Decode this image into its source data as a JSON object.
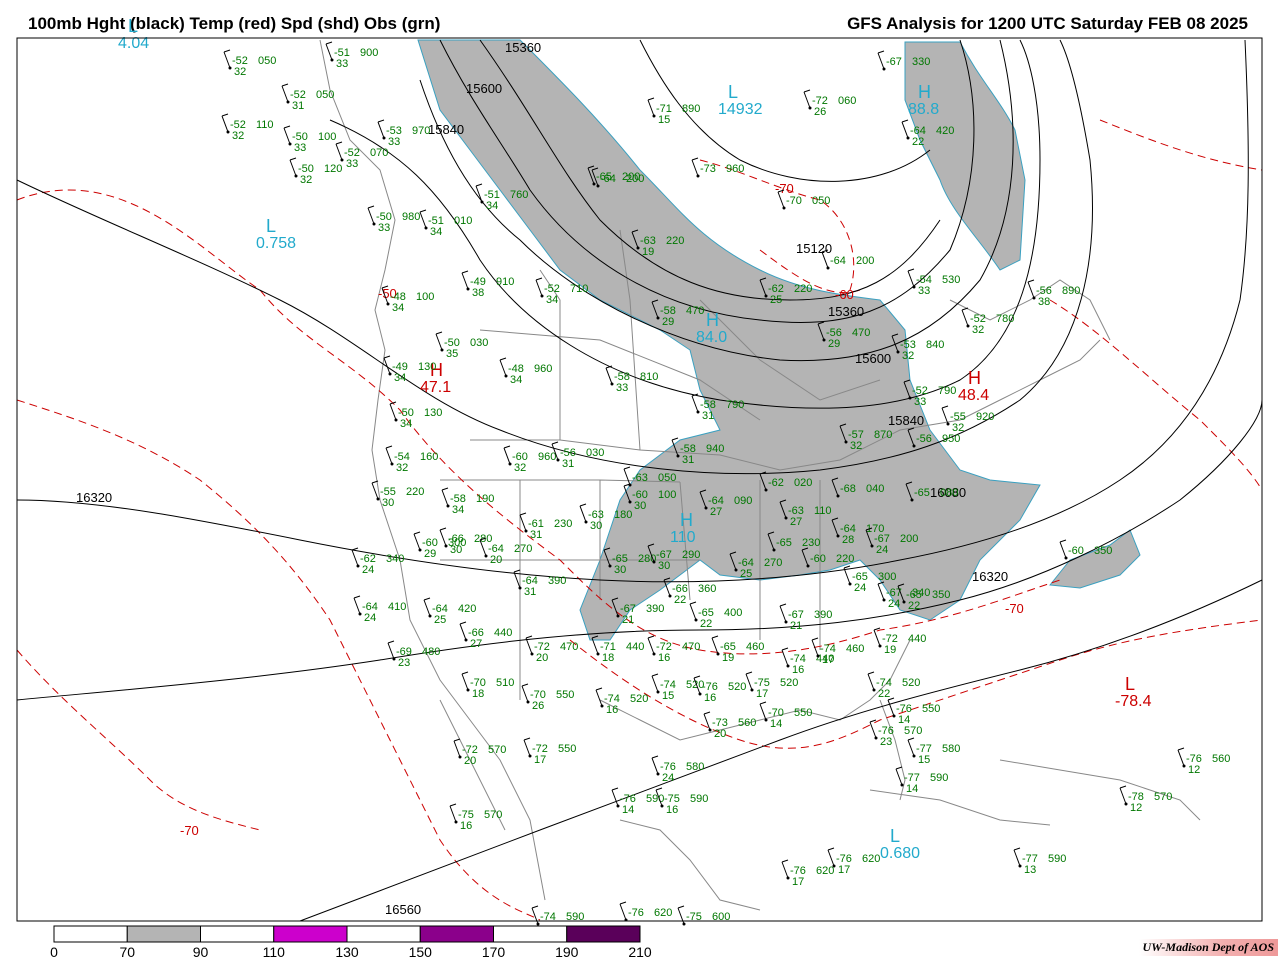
{
  "header": {
    "title_left": "100mb Hght (black) Temp (red) Spd (shd) Obs (grn)",
    "title_right": "GFS Analysis for 1200 UTC Saturday  FEB 08 2025"
  },
  "colors": {
    "height_contour": "#000000",
    "temp_contour": "#cc0000",
    "wind_shade": "#b4b4b4",
    "obs_text": "#007700",
    "center_label": "#22aacc",
    "geo_lines": "#888888"
  },
  "height_labels": [
    "15360",
    "15600",
    "15840",
    "15120",
    "15360",
    "15600",
    "15840",
    "16080",
    "16320",
    "16320",
    "16560"
  ],
  "centers": [
    {
      "type": "L",
      "value": "4.04"
    },
    {
      "type": "L",
      "value": "0.758"
    },
    {
      "type": "L",
      "value": "14932"
    },
    {
      "type": "H",
      "value": "88.8"
    },
    {
      "type": "H",
      "value": "84.0"
    },
    {
      "type": "H",
      "value": "110"
    },
    {
      "type": "H",
      "value": "47.1"
    },
    {
      "type": "H",
      "value": "48.4"
    },
    {
      "type": "L",
      "value": "-78.4"
    },
    {
      "type": "L",
      "value": "0.680"
    }
  ],
  "temp_labels": [
    "-70",
    "-60",
    "-50",
    "-70",
    "-70"
  ],
  "observations": [
    {
      "t": "-52",
      "d": "32",
      "h": "050"
    },
    {
      "t": "-51",
      "d": "33",
      "h": "900"
    },
    {
      "t": "-52",
      "d": "31",
      "h": "050"
    },
    {
      "t": "-53",
      "d": "33",
      "h": "970"
    },
    {
      "t": "-52",
      "d": "32",
      "h": "110"
    },
    {
      "t": "-50",
      "d": "33",
      "h": "100"
    },
    {
      "t": "-52",
      "d": "33",
      "h": "070"
    },
    {
      "t": "-50",
      "d": "32",
      "h": "120"
    },
    {
      "t": "-50",
      "d": "33",
      "h": "980"
    },
    {
      "t": "-51",
      "d": "34",
      "h": "010"
    },
    {
      "t": "-51",
      "d": "34",
      "h": "760"
    },
    {
      "t": "-52",
      "d": "34",
      "h": "710"
    },
    {
      "t": "-49",
      "d": "38",
      "h": "910"
    },
    {
      "t": "-48",
      "d": "34",
      "h": "100"
    },
    {
      "t": "-50",
      "d": "35",
      "h": "030"
    },
    {
      "t": "-49",
      "d": "34",
      "h": "130"
    },
    {
      "t": "-48",
      "d": "34",
      "h": "960"
    },
    {
      "t": "-50",
      "d": "34",
      "h": "130"
    },
    {
      "t": "-54",
      "d": "32",
      "h": "160"
    },
    {
      "t": "-60",
      "d": "32",
      "h": "960"
    },
    {
      "t": "-56",
      "d": "31",
      "h": "030"
    },
    {
      "t": "-58",
      "d": "33",
      "h": "810"
    },
    {
      "t": "-55",
      "d": "30",
      "h": "220"
    },
    {
      "t": "-58",
      "d": "34",
      "h": "190"
    },
    {
      "t": "-60",
      "d": "29",
      "h": "300"
    },
    {
      "t": "-66",
      "d": "30",
      "h": "280"
    },
    {
      "t": "-62",
      "d": "24",
      "h": "340"
    },
    {
      "t": "-61",
      "d": "31",
      "h": "230"
    },
    {
      "t": "-64",
      "d": "20",
      "h": "270"
    },
    {
      "t": "-64",
      "d": "31",
      "h": "390"
    },
    {
      "t": "-64",
      "d": "24",
      "h": "410"
    },
    {
      "t": "-64",
      "d": "25",
      "h": "420"
    },
    {
      "t": "-66",
      "d": "27",
      "h": "440"
    },
    {
      "t": "-69",
      "d": "23",
      "h": "480"
    },
    {
      "t": "-70",
      "d": "18",
      "h": "510"
    },
    {
      "t": "-70",
      "d": "26",
      "h": "550"
    },
    {
      "t": "-72",
      "d": "20",
      "h": "570"
    },
    {
      "t": "-72",
      "d": "17",
      "h": "550"
    },
    {
      "t": "-75",
      "d": "16",
      "h": "570"
    },
    {
      "t": "-72",
      "d": "20",
      "h": "470"
    },
    {
      "t": "-71",
      "d": "18",
      "h": "440"
    },
    {
      "t": "-72",
      "d": "16",
      "h": "470"
    },
    {
      "t": "-74",
      "d": "16",
      "h": "520"
    },
    {
      "t": "-74",
      "d": "15",
      "h": "520"
    },
    {
      "t": "-76",
      "d": "16",
      "h": "520"
    },
    {
      "t": "-75",
      "d": "17",
      "h": "520"
    },
    {
      "t": "-70",
      "d": "14",
      "h": "550"
    },
    {
      "t": "-73",
      "d": "20",
      "h": "560"
    },
    {
      "t": "-76",
      "d": "24",
      "h": "580"
    },
    {
      "t": "-76",
      "d": "14",
      "h": "590"
    },
    {
      "t": "-75",
      "d": "16",
      "h": "590"
    },
    {
      "t": "-67",
      "d": "21",
      "h": "390"
    },
    {
      "t": "-65",
      "d": "22",
      "h": "400"
    },
    {
      "t": "-66",
      "d": "22",
      "h": "360"
    },
    {
      "t": "-67",
      "d": "21",
      "h": "390"
    },
    {
      "t": "-65",
      "d": "19",
      "h": "460"
    },
    {
      "t": "-74",
      "d": "16",
      "h": "440"
    },
    {
      "t": "-74",
      "d": "17",
      "h": "460"
    },
    {
      "t": "-72",
      "d": "19",
      "h": "440"
    },
    {
      "t": "-74",
      "d": "22",
      "h": "520"
    },
    {
      "t": "-76",
      "d": "14",
      "h": "550"
    },
    {
      "t": "-76",
      "d": "23",
      "h": "570"
    },
    {
      "t": "-77",
      "d": "15",
      "h": "580"
    },
    {
      "t": "-77",
      "d": "14",
      "h": "590"
    },
    {
      "t": "-76",
      "d": "12",
      "h": "560"
    },
    {
      "t": "-78",
      "d": "12",
      "h": "570"
    },
    {
      "t": "-77",
      "d": "13",
      "h": "590"
    },
    {
      "t": "-76",
      "d": "17",
      "h": "620"
    },
    {
      "t": "-76",
      "d": "17",
      "h": "620"
    },
    {
      "t": "-74",
      "d": "",
      "h": "590"
    },
    {
      "t": "-76",
      "d": "",
      "h": "620"
    },
    {
      "t": "-75",
      "d": "",
      "h": "600"
    },
    {
      "t": "-60",
      "d": "",
      "h": "350"
    },
    {
      "t": "-62",
      "d": "25",
      "h": "220"
    },
    {
      "t": "-64",
      "d": "",
      "h": "200"
    },
    {
      "t": "-63",
      "d": "19",
      "h": "220"
    },
    {
      "t": "-58",
      "d": "29",
      "h": "470"
    },
    {
      "t": "-56",
      "d": "29",
      "h": "470"
    },
    {
      "t": "-53",
      "d": "32",
      "h": "840"
    },
    {
      "t": "-54",
      "d": "33",
      "h": "530"
    },
    {
      "t": "-56",
      "d": "38",
      "h": "890"
    },
    {
      "t": "-52",
      "d": "32",
      "h": "780"
    },
    {
      "t": "-52",
      "d": "33",
      "h": "790"
    },
    {
      "t": "-55",
      "d": "32",
      "h": "920"
    },
    {
      "t": "-56",
      "d": "",
      "h": "950"
    },
    {
      "t": "-58",
      "d": "31",
      "h": "790"
    },
    {
      "t": "-58",
      "d": "31",
      "h": "940"
    },
    {
      "t": "-57",
      "d": "32",
      "h": "870"
    },
    {
      "t": "-63",
      "d": "",
      "h": "050"
    },
    {
      "t": "-60",
      "d": "30",
      "h": "100"
    },
    {
      "t": "-64",
      "d": "27",
      "h": "090"
    },
    {
      "t": "-62",
      "d": "",
      "h": "020"
    },
    {
      "t": "-63",
      "d": "27",
      "h": "110"
    },
    {
      "t": "-68",
      "d": "",
      "h": "040"
    },
    {
      "t": "-65",
      "d": "",
      "h": "080"
    },
    {
      "t": "-64",
      "d": "28",
      "h": "170"
    },
    {
      "t": "-67",
      "d": "24",
      "h": "200"
    },
    {
      "t": "-64",
      "d": "25",
      "h": "270"
    },
    {
      "t": "-65",
      "d": "",
      "h": "230"
    },
    {
      "t": "-60",
      "d": "",
      "h": "220"
    },
    {
      "t": "-65",
      "d": "24",
      "h": "300"
    },
    {
      "t": "-67",
      "d": "24",
      "h": "340"
    },
    {
      "t": "-65",
      "d": "22",
      "h": "350"
    },
    {
      "t": "-65",
      "d": "30",
      "h": "280"
    },
    {
      "t": "-67",
      "d": "30",
      "h": "290"
    },
    {
      "t": "-63",
      "d": "30",
      "h": "180"
    },
    {
      "t": "-67",
      "d": "",
      "h": "330"
    },
    {
      "t": "-64",
      "d": "22",
      "h": "420"
    },
    {
      "t": "-72",
      "d": "26",
      "h": "060"
    },
    {
      "t": "-71",
      "d": "15",
      "h": "890"
    },
    {
      "t": "-73",
      "d": "",
      "h": "960"
    },
    {
      "t": "-70",
      "d": "",
      "h": "050"
    },
    {
      "t": "-64",
      "d": "",
      "h": "200"
    },
    {
      "t": "-65",
      "d": "",
      "h": "200"
    }
  ],
  "legend": {
    "ticks": [
      "0",
      "70",
      "90",
      "110",
      "130",
      "150",
      "170",
      "190",
      "210"
    ],
    "colors": [
      "#ffffff",
      "#b4b4b4",
      "#ffffff",
      "#cc00cc",
      "#ffffff",
      "#8b008b",
      "#ffffff",
      "#5a005a"
    ]
  },
  "credit": "UW-Madison  Dept of AOS"
}
